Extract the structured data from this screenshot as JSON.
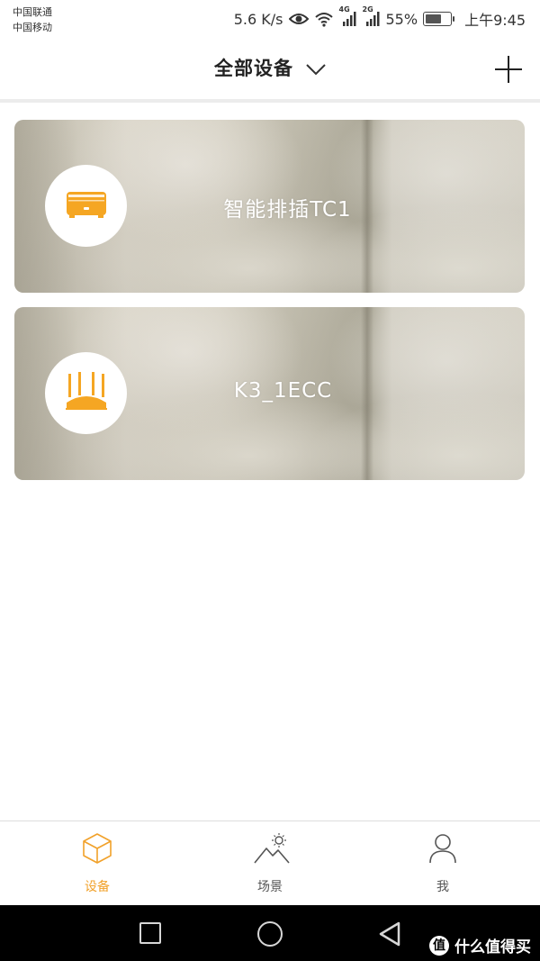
{
  "status_bar": {
    "carrier_1": "中国联通",
    "carrier_2": "中国移动",
    "net_speed": "5.6 K/s",
    "network_1": "4G",
    "network_2": "2G",
    "battery": "55%",
    "time": "上午9:45"
  },
  "header": {
    "title": "全部设备",
    "dropdown_icon": "chevron-down-icon",
    "add_icon": "plus-icon"
  },
  "devices": [
    {
      "name": "智能排插TC1",
      "icon": "power-strip-icon"
    },
    {
      "name": "K3_1ECC",
      "icon": "router-icon"
    }
  ],
  "tabs": [
    {
      "label": "设备",
      "icon": "cube-icon",
      "active": true
    },
    {
      "label": "场景",
      "icon": "mountain-sun-icon",
      "active": false
    },
    {
      "label": "我",
      "icon": "person-icon",
      "active": false
    }
  ],
  "watermark": {
    "logo": "值",
    "text": "什么值得买"
  },
  "colors": {
    "accent": "#f1a12a",
    "nav_bg": "#000000"
  }
}
